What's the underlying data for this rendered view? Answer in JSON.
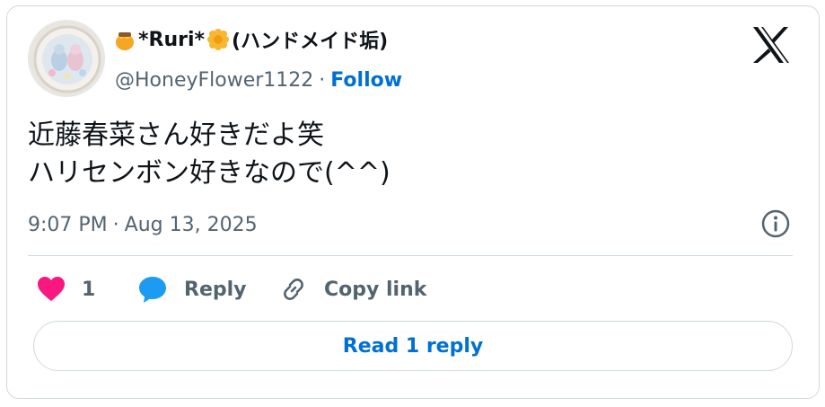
{
  "author": {
    "display_name": "*Ruri*",
    "display_suffix": "(ハンドメイド垢)",
    "handle": "@HoneyFlower1122",
    "separator": "·",
    "follow_label": "Follow",
    "name_emoji_left": "honey-pot-icon",
    "name_emoji_right": "blossom-icon"
  },
  "tweet": {
    "text": "近藤春菜さん好きだよ笑\nハリセンボン好きなので(^^)",
    "time": "9:07 PM",
    "separator": "·",
    "date": "Aug 13, 2025"
  },
  "actions": {
    "like_count": "1",
    "reply_label": "Reply",
    "copy_label": "Copy link"
  },
  "read_reply_label": "Read 1 reply",
  "colors": {
    "like": "#f91880",
    "reply_bubble": "#1d9bf0",
    "link": "#006fd6",
    "muted": "#536471"
  }
}
